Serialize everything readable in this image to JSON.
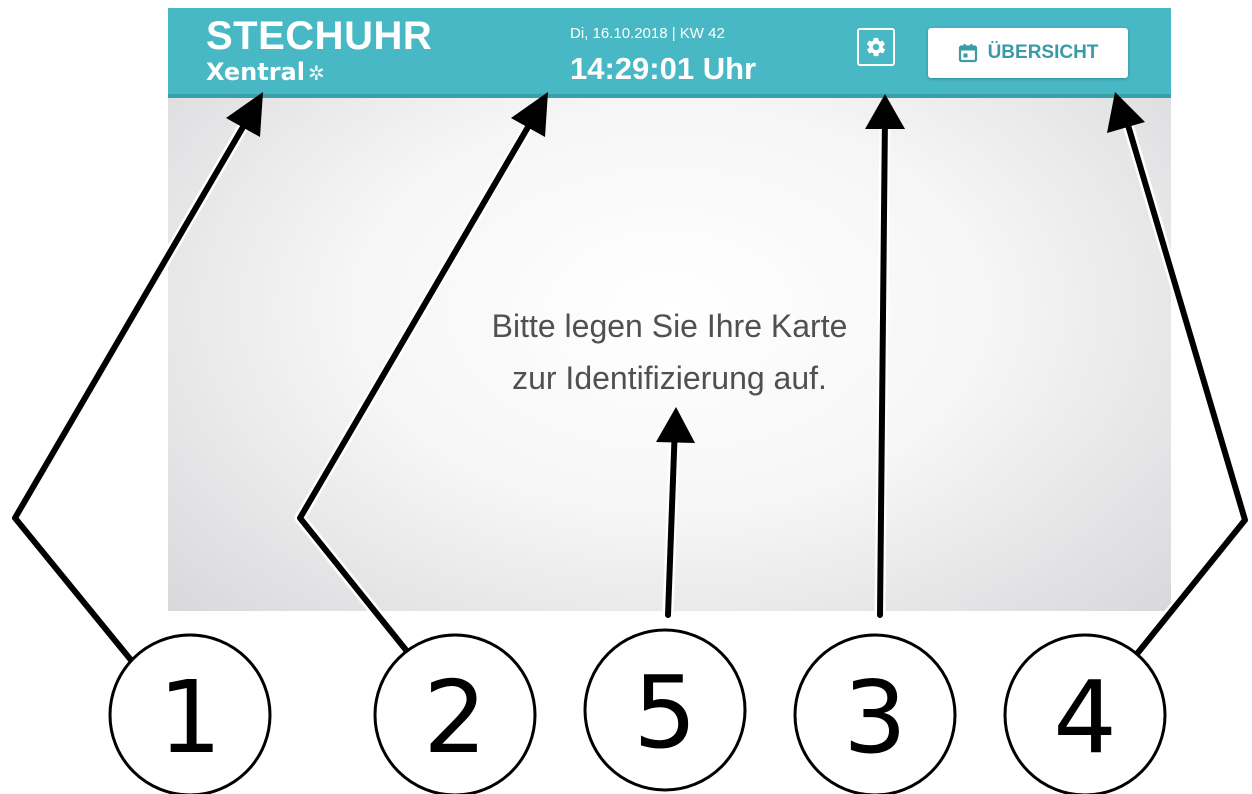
{
  "header": {
    "title": "STECHUHR",
    "logo_text": "Xentral",
    "logo_mark": "✲",
    "date": "Di, 16.10.2018 | KW 42",
    "time": "14:29:01 Uhr",
    "settings_icon": "gear-icon",
    "overview_icon": "calendar-icon",
    "overview_label": "ÜBERSICHT"
  },
  "main": {
    "prompt_line1": "Bitte legen Sie Ihre Karte",
    "prompt_line2": "zur Identifizierung auf."
  },
  "callouts": [
    "1",
    "2",
    "5",
    "3",
    "4"
  ],
  "colors": {
    "header_bg": "#48b8c4",
    "accent": "#3a9aa6",
    "text": "#505050"
  }
}
